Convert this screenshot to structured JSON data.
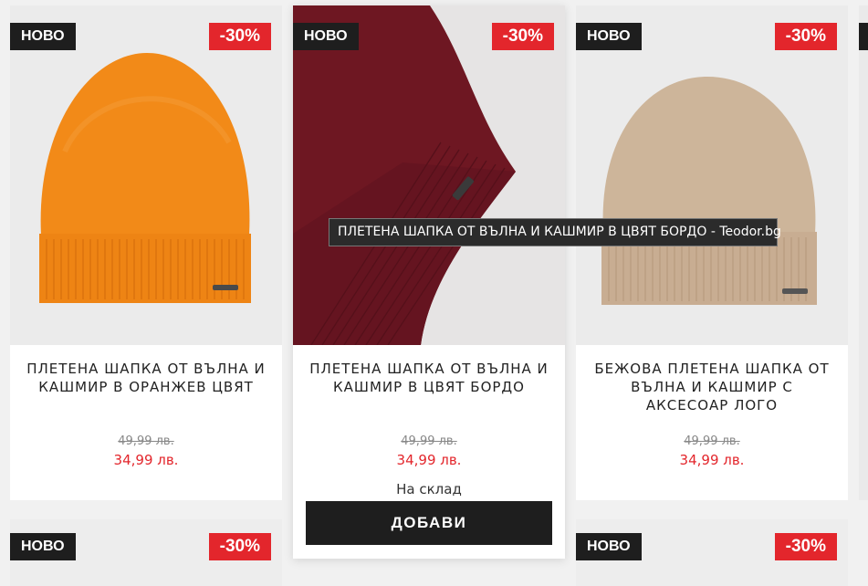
{
  "colors": {
    "accent": "#e3262c",
    "dark": "#1e1e1e",
    "orange_hat": "#f28a18",
    "bordeaux_hat": "#6e1722",
    "beige_hat": "#cdb59a"
  },
  "products": [
    {
      "badge_new": "НОВО",
      "badge_sale": "-30%",
      "title": "ПЛЕТЕНА ШАПКА ОТ ВЪЛНА И КАШМИР В ОРАНЖЕВ ЦВЯТ",
      "old_price": "49,99 лв.",
      "new_price": "34,99 лв."
    },
    {
      "badge_new": "НОВО",
      "badge_sale": "-30%",
      "title": "ПЛЕТЕНА ШАПКА ОТ ВЪЛНА И КАШМИР В ЦВЯТ БОРДО",
      "old_price": "49,99 лв.",
      "new_price": "34,99 лв.",
      "stock": "На склад",
      "add_label": "ДОБАВИ"
    },
    {
      "badge_new": "НОВО",
      "badge_sale": "-30%",
      "title": "БЕЖОВА ПЛЕТЕНА ШАПКА ОТ ВЪЛНА И КАШМИР С АКСЕСОАР ЛОГО",
      "old_price": "49,99 лв.",
      "new_price": "34,99 лв."
    },
    {
      "badge_new": "НОВО",
      "badge_sale": "-30%"
    },
    {
      "badge_new": "НОВО",
      "badge_sale": "-30%"
    }
  ],
  "tooltip": "ПЛЕТЕНА ШАПКА ОТ ВЪЛНА И КАШМИР В ЦВЯТ БОРДО - Teodor.bg"
}
